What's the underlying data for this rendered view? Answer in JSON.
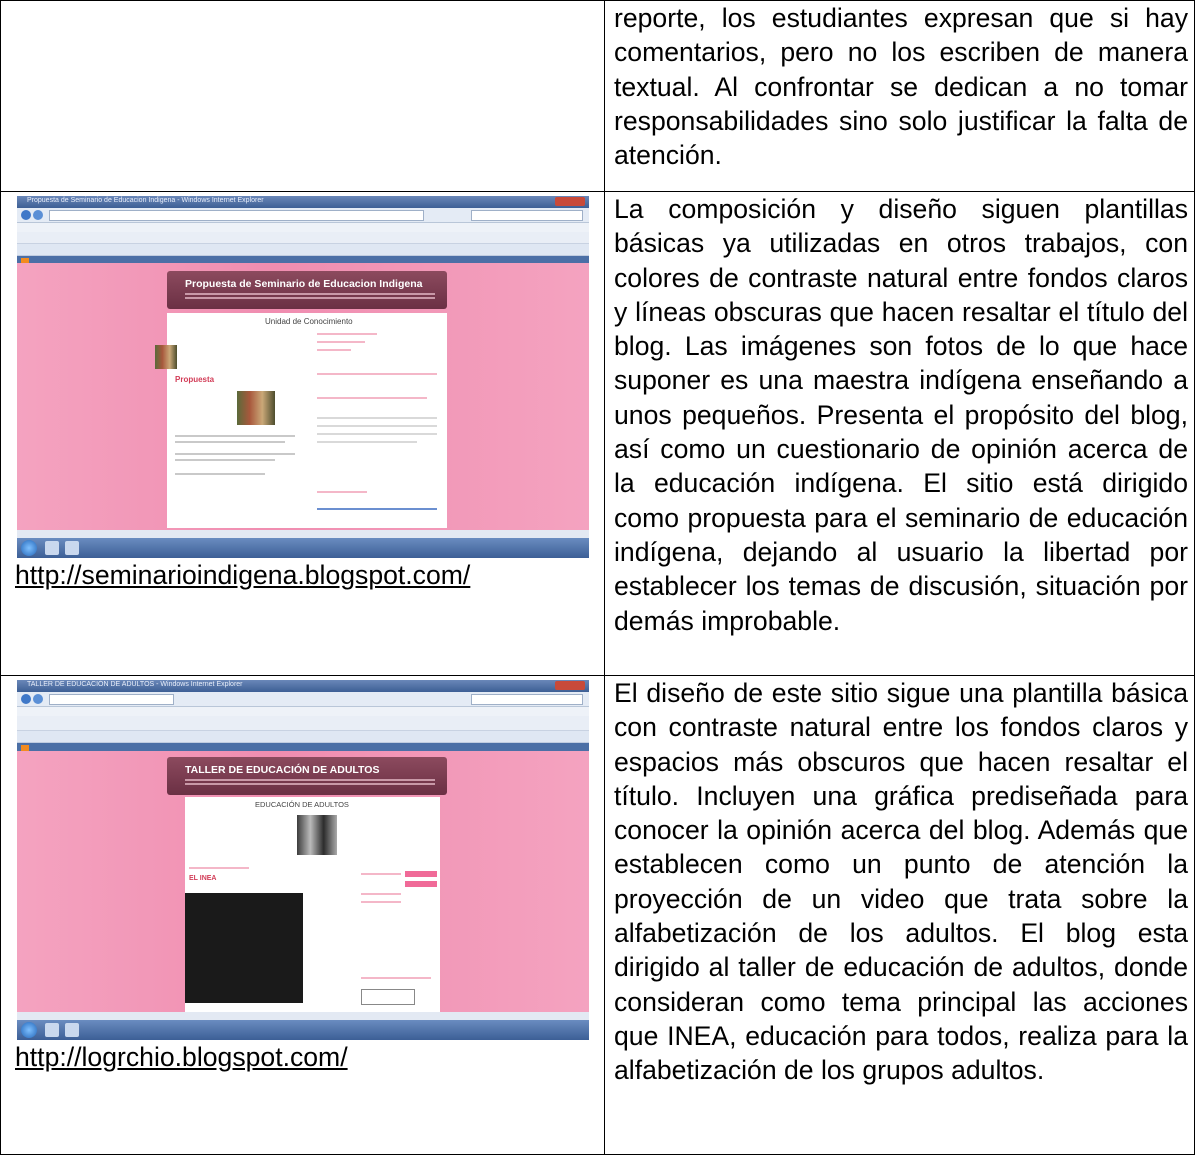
{
  "rows": [
    {
      "text": "reporte, los estudiantes expresan que si hay comentarios, pero no los escriben de manera textual. Al confrontar se dedican a no tomar responsabilidades sino solo justificar la falta de atención."
    },
    {
      "url": "http://seminarioindigena.blogspot.com/",
      "screenshot": {
        "window_title": "Propuesta de Seminario de Educacion Indigena - Windows Internet Explorer",
        "blog_title": "Propuesta de Seminario de Educacion Indigena",
        "section_title": "Unidad de Conocimiento",
        "post_title": "Propuesta"
      },
      "text": "La composición y diseño siguen plantillas básicas ya utilizadas en otros trabajos, con colores de contraste natural entre fondos claros y líneas obscuras que hacen resaltar el título del blog. Las imágenes son fotos de lo que hace suponer  es una maestra indígena enseñando a unos pequeños.  Presenta el propósito del blog, así como un cuestionario de opinión acerca de la educación indígena. El sitio está dirigido como propuesta para el seminario de educación indígena, dejando al usuario la libertad por establecer los temas de discusión, situación por demás improbable."
    },
    {
      "url": "http://logrchio.blogspot.com/",
      "screenshot": {
        "window_title": "TALLER DE EDUCACIÓN DE ADULTOS - Windows Internet Explorer",
        "blog_title": "TALLER DE EDUCACIÓN DE ADULTOS",
        "section_title": "EDUCACIÓN DE ADULTOS",
        "post_title": "EL INEA"
      },
      "text": "El diseño de este sitio sigue una plantilla básica con contraste natural entre los fondos claros y espacios más obscuros que hacen resaltar el título. Incluyen una gráfica prediseñada para conocer la opinión acerca del blog. Además que establecen como un punto de atención la proyección de un video que trata sobre la alfabetización de los adultos.  El blog esta dirigido al taller de educación de adultos, donde consideran  como tema principal las acciones que INEA, educación para todos, realiza para la alfabetización de los grupos adultos."
    }
  ]
}
